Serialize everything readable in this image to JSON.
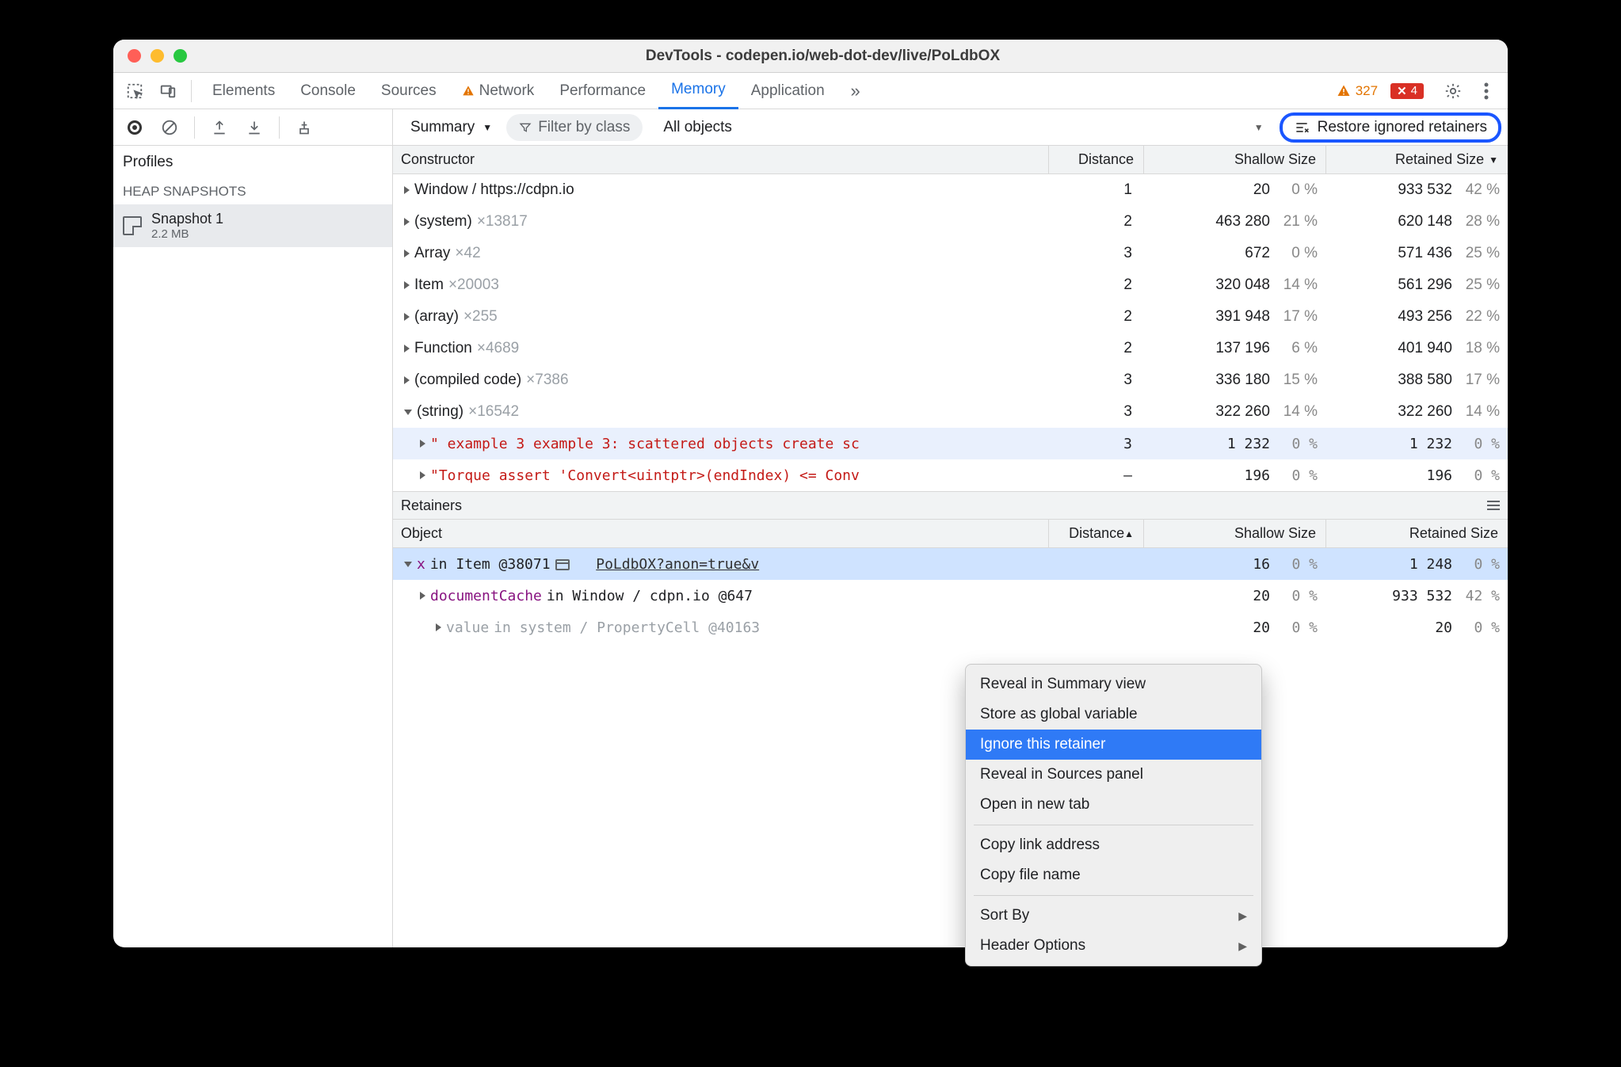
{
  "titlebar": {
    "title": "DevTools - codepen.io/web-dot-dev/live/PoLdbOX"
  },
  "tabs": {
    "items": [
      "Elements",
      "Console",
      "Sources",
      "Network",
      "Performance",
      "Memory",
      "Application"
    ],
    "active": "Memory",
    "warn_count": "327",
    "err_count": "4"
  },
  "toolbar": {
    "view_mode": "Summary",
    "filter_placeholder": "Filter by class",
    "objects_filter": "All objects",
    "restore_label": "Restore ignored retainers"
  },
  "sidebar": {
    "profiles_label": "Profiles",
    "heap_label": "HEAP SNAPSHOTS",
    "snapshot": {
      "name": "Snapshot 1",
      "size": "2.2 MB"
    }
  },
  "columns": {
    "constructor": "Constructor",
    "distance": "Distance",
    "shallow": "Shallow Size",
    "retained": "Retained Size"
  },
  "rows": [
    {
      "name": "Window / https://cdpn.io",
      "count": "",
      "dist": "1",
      "shv": "20",
      "shp": "0 %",
      "rev": "933 532",
      "rep": "42 %",
      "indent": 0,
      "open": false
    },
    {
      "name": "(system)",
      "count": "×13817",
      "dist": "2",
      "shv": "463 280",
      "shp": "21 %",
      "rev": "620 148",
      "rep": "28 %",
      "indent": 0,
      "open": false
    },
    {
      "name": "Array",
      "count": "×42",
      "dist": "3",
      "shv": "672",
      "shp": "0 %",
      "rev": "571 436",
      "rep": "25 %",
      "indent": 0,
      "open": false
    },
    {
      "name": "Item",
      "count": "×20003",
      "dist": "2",
      "shv": "320 048",
      "shp": "14 %",
      "rev": "561 296",
      "rep": "25 %",
      "indent": 0,
      "open": false
    },
    {
      "name": "(array)",
      "count": "×255",
      "dist": "2",
      "shv": "391 948",
      "shp": "17 %",
      "rev": "493 256",
      "rep": "22 %",
      "indent": 0,
      "open": false
    },
    {
      "name": "Function",
      "count": "×4689",
      "dist": "2",
      "shv": "137 196",
      "shp": "6 %",
      "rev": "401 940",
      "rep": "18 %",
      "indent": 0,
      "open": false
    },
    {
      "name": "(compiled code)",
      "count": "×7386",
      "dist": "3",
      "shv": "336 180",
      "shp": "15 %",
      "rev": "388 580",
      "rep": "17 %",
      "indent": 0,
      "open": false
    },
    {
      "name": "(string)",
      "count": "×16542",
      "dist": "3",
      "shv": "322 260",
      "shp": "14 %",
      "rev": "322 260",
      "rep": "14 %",
      "indent": 0,
      "open": true
    }
  ],
  "stringrows": [
    {
      "txt": "\" example 3 example 3: scattered objects create sc",
      "dist": "3",
      "shv": "1 232",
      "shp": "0 %",
      "rev": "1 232",
      "rep": "0 %",
      "sel": true
    },
    {
      "txt": "\"Torque assert 'Convert<uintptr>(endIndex) <= Conv",
      "dist": "—",
      "shv": "196",
      "shp": "0 %",
      "rev": "196",
      "rep": "0 %",
      "sel": false
    }
  ],
  "retainers": {
    "title": "Retainers",
    "cols": {
      "object": "Object",
      "distance": "Distance",
      "shallow": "Shallow Size",
      "retained": "Retained Size"
    },
    "rows": [
      {
        "pre": "x",
        "mid": " in Item @38071 ",
        "link": "PoLdbOX?anon=true&v",
        "dist": "",
        "shv": "16",
        "shp": "0 %",
        "rev": "1 248",
        "rep": "0 %",
        "sel": true,
        "open": true,
        "purple": true,
        "haslink": true,
        "gray": false
      },
      {
        "pre": "documentCache",
        "mid": " in Window / cdpn.io @647",
        "link": "",
        "dist": "",
        "shv": "20",
        "shp": "0 %",
        "rev": "933 532",
        "rep": "42 %",
        "sel": false,
        "open": false,
        "purple": true,
        "haslink": false,
        "gray": false
      },
      {
        "pre": "value",
        "mid": " in system / PropertyCell @40163",
        "link": "",
        "dist": "",
        "shv": "20",
        "shp": "0 %",
        "rev": "20",
        "rep": "0 %",
        "sel": false,
        "open": false,
        "purple": false,
        "haslink": false,
        "gray": true
      }
    ]
  },
  "ctx": {
    "items": [
      {
        "label": "Reveal in Summary view",
        "hl": false,
        "sub": false
      },
      {
        "label": "Store as global variable",
        "hl": false,
        "sub": false
      },
      {
        "label": "Ignore this retainer",
        "hl": true,
        "sub": false
      },
      {
        "label": "Reveal in Sources panel",
        "hl": false,
        "sub": false
      },
      {
        "label": "Open in new tab",
        "hl": false,
        "sub": false
      },
      {
        "sep": true
      },
      {
        "label": "Copy link address",
        "hl": false,
        "sub": false
      },
      {
        "label": "Copy file name",
        "hl": false,
        "sub": false
      },
      {
        "sep": true
      },
      {
        "label": "Sort By",
        "hl": false,
        "sub": true
      },
      {
        "label": "Header Options",
        "hl": false,
        "sub": true
      }
    ]
  }
}
